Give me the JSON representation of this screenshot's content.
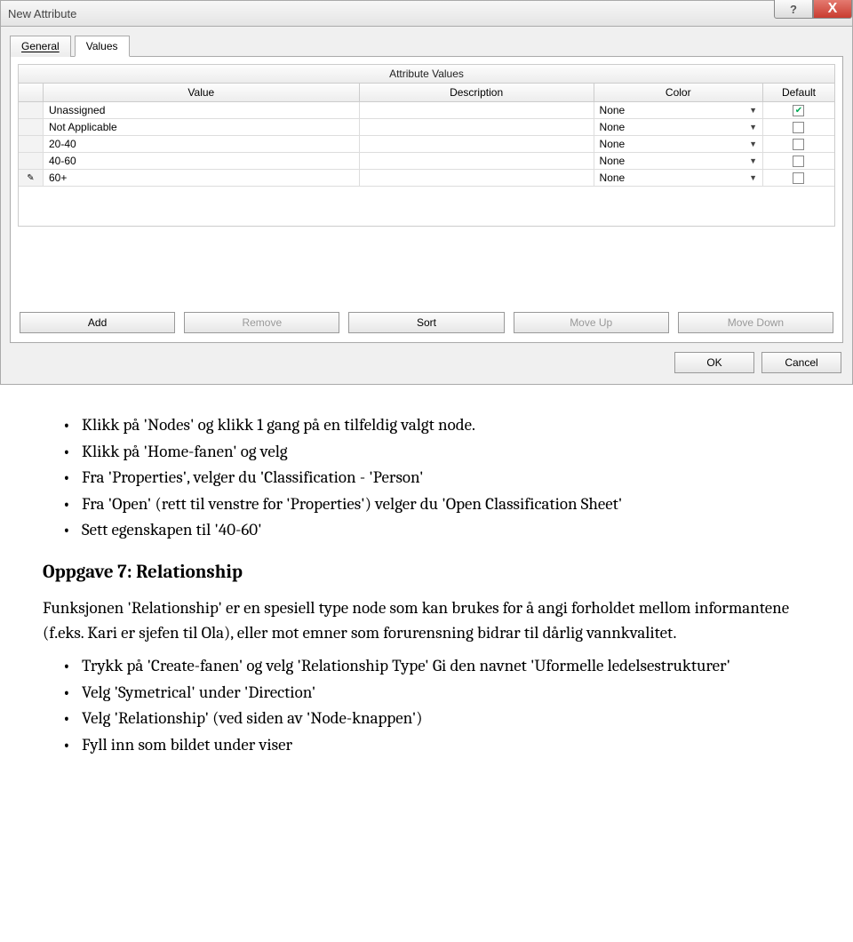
{
  "window": {
    "title": "New Attribute",
    "help_glyph": "?",
    "close_glyph": "X"
  },
  "tabs": {
    "general": "General",
    "values": "Values"
  },
  "section_title": "Attribute Values",
  "columns": {
    "value": "Value",
    "description": "Description",
    "color": "Color",
    "default": "Default"
  },
  "rows": [
    {
      "gutter": "",
      "value": "Unassigned",
      "desc": "",
      "color": "None",
      "default_checked": true
    },
    {
      "gutter": "",
      "value": "Not Applicable",
      "desc": "",
      "color": "None",
      "default_checked": false
    },
    {
      "gutter": "",
      "value": "20-40",
      "desc": "",
      "color": "None",
      "default_checked": false
    },
    {
      "gutter": "",
      "value": "40-60",
      "desc": "",
      "color": "None",
      "default_checked": false
    },
    {
      "gutter": "✎",
      "value": "60+",
      "desc": "",
      "color": "None",
      "default_checked": false
    }
  ],
  "buttons": {
    "add": "Add",
    "remove": "Remove",
    "sort": "Sort",
    "move_up": "Move Up",
    "move_down": "Move Down",
    "ok": "OK",
    "cancel": "Cancel"
  },
  "doc": {
    "bullets_top": [
      "Klikk på 'Nodes' og klikk 1 gang på en tilfeldig valgt node.",
      "Klikk på 'Home-fanen' og velg",
      "Fra 'Properties', velger du 'Classification - 'Person'",
      "Fra 'Open' (rett til venstre for 'Properties') velger du 'Open Classification Sheet'",
      "Sett egenskapen til '40-60'"
    ],
    "heading": "Oppgave 7: Relationship",
    "paragraph": "Funksjonen 'Relationship' er en spesiell type node som kan brukes for å angi forholdet mellom informantene (f.eks. Kari er sjefen til Ola), eller mot emner som forurensning bidrar til dårlig vannkvalitet.",
    "bullets_bottom": [
      "Trykk på 'Create-fanen' og velg 'Relationship Type' Gi den navnet 'Uformelle ledelsestrukturer'",
      "Velg 'Symetrical' under 'Direction'",
      "Velg 'Relationship' (ved siden av 'Node-knappen')",
      "Fyll inn som bildet under viser"
    ]
  }
}
